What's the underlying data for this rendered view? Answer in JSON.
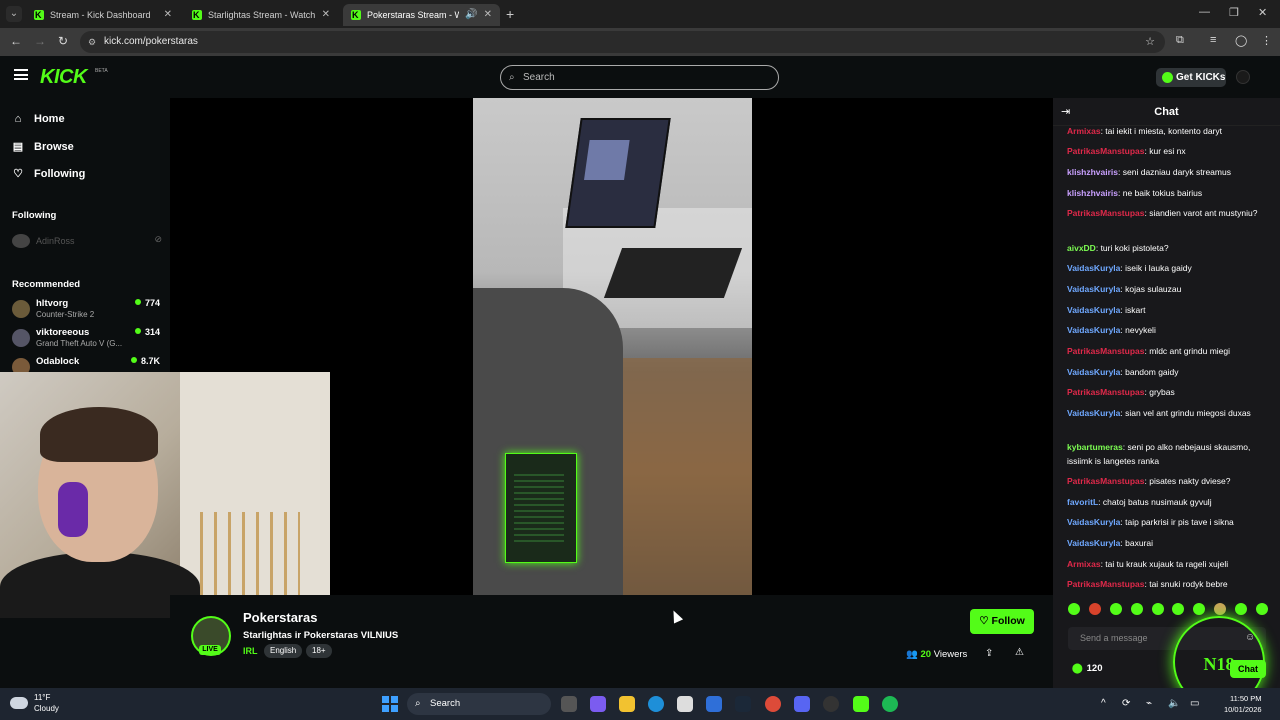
{
  "browser": {
    "tabs": [
      {
        "label": "Stream - Kick Dashboard",
        "active": false
      },
      {
        "label": "Starlightas Stream - Watch Live",
        "active": false
      },
      {
        "label": "Pokerstaras Stream - Watch",
        "active": true
      }
    ],
    "url": "kick.com/pokerstaras"
  },
  "header": {
    "logo": "KICK",
    "beta": "BETA",
    "search_placeholder": "Search",
    "get_kicks": "Get KICKs"
  },
  "sidebar": {
    "nav": [
      {
        "label": "Home",
        "icon": "home-icon"
      },
      {
        "label": "Browse",
        "icon": "browse-icon"
      },
      {
        "label": "Following",
        "icon": "heart-icon"
      }
    ],
    "following_heading": "Following",
    "following": [
      {
        "name": "AdinRoss",
        "status": "offline"
      }
    ],
    "recommended_heading": "Recommended",
    "recommended": [
      {
        "name": "hltvorg",
        "game": "Counter-Strike 2",
        "viewers": "774"
      },
      {
        "name": "viktoreeous",
        "game": "Grand Theft Auto V (G...",
        "viewers": "314"
      },
      {
        "name": "Odablock",
        "game": "",
        "viewers": "8.7K"
      }
    ]
  },
  "stream": {
    "channel": "Pokerstaras",
    "title": "Starlightas ir Pokerstaras VILNIUS",
    "category": "IRL",
    "tags": [
      "English",
      "18+"
    ],
    "live_badge": "LIVE",
    "avatar_text": "POKER",
    "follow_label": "Follow",
    "viewers_count": "20",
    "viewers_label": "Viewers"
  },
  "chat": {
    "title": "Chat",
    "messages": [
      {
        "user": "Armixas",
        "color": "#e0294a",
        "text": "tai iekit i miesta, kontento daryt"
      },
      {
        "user": "PatrikasManstupas",
        "color": "#e0294a",
        "text": "kur esi nx"
      },
      {
        "user": "klishzhvairis",
        "color": "#c9a0ff",
        "text": "seni dazniau daryk streamus"
      },
      {
        "user": "klishzhvairis",
        "color": "#c9a0ff",
        "text": "ne baik tokius bairius"
      },
      {
        "user": "PatrikasManstupas",
        "color": "#e0294a",
        "text": "siandien varot ant mustyniu?"
      },
      {
        "user": "aivxDD",
        "color": "#7cfc52",
        "text": "turi koki pistoleta?"
      },
      {
        "user": "VaidasKuryla",
        "color": "#6fa8ff",
        "text": "iseik i lauka gaidy"
      },
      {
        "user": "VaidasKuryla",
        "color": "#6fa8ff",
        "text": "kojas sulauzau"
      },
      {
        "user": "VaidasKuryla",
        "color": "#6fa8ff",
        "text": "iskart"
      },
      {
        "user": "VaidasKuryla",
        "color": "#6fa8ff",
        "text": "nevykeli"
      },
      {
        "user": "PatrikasManstupas",
        "color": "#e0294a",
        "text": "mldc ant grindu miegi"
      },
      {
        "user": "VaidasKuryla",
        "color": "#6fa8ff",
        "text": "bandom gaidy"
      },
      {
        "user": "PatrikasManstupas",
        "color": "#e0294a",
        "text": "grybas"
      },
      {
        "user": "VaidasKuryla",
        "color": "#6fa8ff",
        "text": "sian vel ant grindu miegosi duxas"
      },
      {
        "user": "kybartumeras",
        "color": "#7cfc52",
        "text": "seni po alko nebejausi skausmo, issiimk is langetes ranka"
      },
      {
        "user": "PatrikasManstupas",
        "color": "#e0294a",
        "text": "pisates nakty dviese?"
      },
      {
        "user": "favoritL",
        "color": "#6fa8ff",
        "text": "chatoj batus nusimauk gyvulj"
      },
      {
        "user": "VaidasKuryla",
        "color": "#6fa8ff",
        "text": "taip parkrisi ir pis tave i sikna"
      },
      {
        "user": "VaidasKuryla",
        "color": "#6fa8ff",
        "text": "baxurai"
      },
      {
        "user": "Armixas",
        "color": "#e0294a",
        "text": "tai tu krauk xujauk ta rageli xujeli"
      },
      {
        "user": "PatrikasManstupas",
        "color": "#e0294a",
        "text": "tai snuki rodyk bebre"
      }
    ],
    "input_placeholder": "Send a message",
    "points": "120",
    "chat_button": "Chat",
    "overlay_text": "N18"
  },
  "taskbar": {
    "weather_temp": "11°F",
    "weather_cond": "Cloudy",
    "search_label": "Search",
    "time": "11:50 PM",
    "date": "10/01/2026"
  },
  "colors": {
    "kick_green": "#53fc18",
    "background": "#0b0e0f",
    "chat_bg": "#18181b"
  }
}
